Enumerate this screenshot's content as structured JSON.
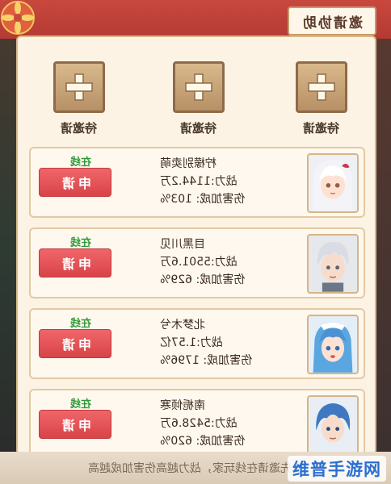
{
  "title": "邀请协助",
  "slots": [
    {
      "label": "待邀请"
    },
    {
      "label": "待邀请"
    },
    {
      "label": "待邀请"
    }
  ],
  "players": [
    {
      "name": "柠檬别卖萌",
      "power": "战力:1144.2万",
      "damage": "伤害加成: 103%",
      "status": "在线",
      "apply": "申请",
      "avatar": "avatar-white-hair-girl"
    },
    {
      "name": "目黑川见",
      "power": "战力:5501.6万",
      "damage": "伤害加成: 629%",
      "status": "在线",
      "apply": "申请",
      "avatar": "avatar-silver-hair-boy"
    },
    {
      "name": "北梦木兮",
      "power": "战力:1.57亿",
      "damage": "伤害加成: 1796%",
      "status": "在线",
      "apply": "申请",
      "avatar": "avatar-blue-hair-girl"
    },
    {
      "name": "南栀倾寒",
      "power": "战力:5428.6万",
      "damage": "伤害加成: 620%",
      "status": "在线",
      "apply": "申请",
      "avatar": "avatar-blue-hair-boy"
    }
  ],
  "footer": "优先邀请在线玩家，战力越高伤害加成越高",
  "watermark": "维普手游网",
  "colors": {
    "accent": "#d84448",
    "online": "#2e9a3a",
    "panel": "#fcf3e4",
    "band": "#c8483e"
  }
}
